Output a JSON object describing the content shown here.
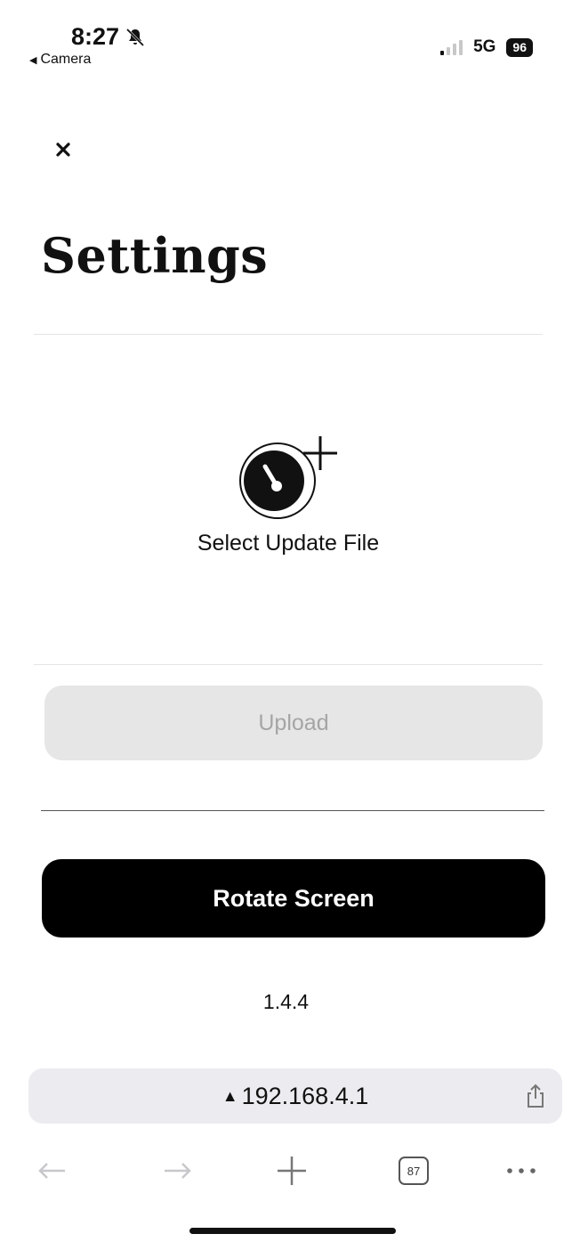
{
  "status_bar": {
    "time": "8:27",
    "back_app": "Camera",
    "network": "5G",
    "battery": "96"
  },
  "page": {
    "title": "Settings"
  },
  "update": {
    "select_label": "Select Update File",
    "upload_label": "Upload"
  },
  "actions": {
    "rotate_label": "Rotate Screen"
  },
  "version": "1.4.4",
  "browser": {
    "url": "192.168.4.1",
    "tab_count": "87"
  }
}
